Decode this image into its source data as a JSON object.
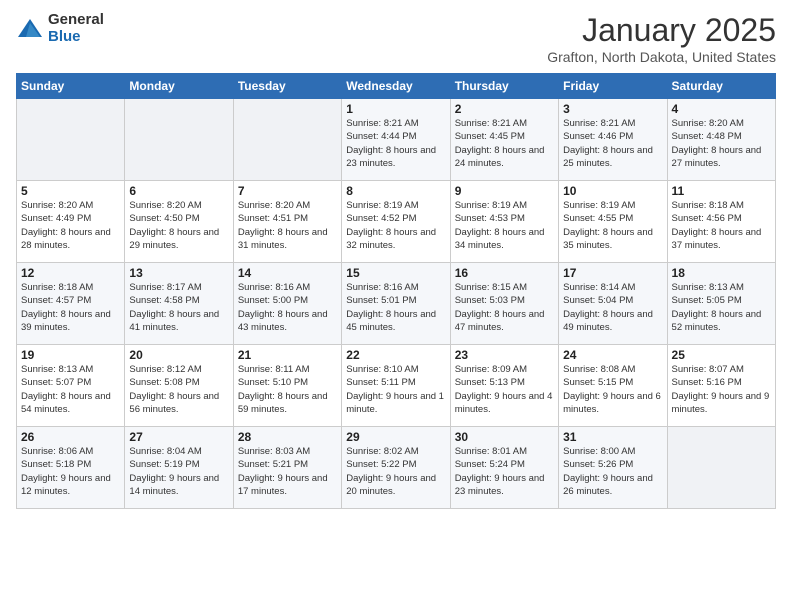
{
  "header": {
    "logo_general": "General",
    "logo_blue": "Blue",
    "month_title": "January 2025",
    "location": "Grafton, North Dakota, United States"
  },
  "weekdays": [
    "Sunday",
    "Monday",
    "Tuesday",
    "Wednesday",
    "Thursday",
    "Friday",
    "Saturday"
  ],
  "weeks": [
    [
      {
        "day": "",
        "info": ""
      },
      {
        "day": "",
        "info": ""
      },
      {
        "day": "",
        "info": ""
      },
      {
        "day": "1",
        "info": "Sunrise: 8:21 AM\nSunset: 4:44 PM\nDaylight: 8 hours and 23 minutes."
      },
      {
        "day": "2",
        "info": "Sunrise: 8:21 AM\nSunset: 4:45 PM\nDaylight: 8 hours and 24 minutes."
      },
      {
        "day": "3",
        "info": "Sunrise: 8:21 AM\nSunset: 4:46 PM\nDaylight: 8 hours and 25 minutes."
      },
      {
        "day": "4",
        "info": "Sunrise: 8:20 AM\nSunset: 4:48 PM\nDaylight: 8 hours and 27 minutes."
      }
    ],
    [
      {
        "day": "5",
        "info": "Sunrise: 8:20 AM\nSunset: 4:49 PM\nDaylight: 8 hours and 28 minutes."
      },
      {
        "day": "6",
        "info": "Sunrise: 8:20 AM\nSunset: 4:50 PM\nDaylight: 8 hours and 29 minutes."
      },
      {
        "day": "7",
        "info": "Sunrise: 8:20 AM\nSunset: 4:51 PM\nDaylight: 8 hours and 31 minutes."
      },
      {
        "day": "8",
        "info": "Sunrise: 8:19 AM\nSunset: 4:52 PM\nDaylight: 8 hours and 32 minutes."
      },
      {
        "day": "9",
        "info": "Sunrise: 8:19 AM\nSunset: 4:53 PM\nDaylight: 8 hours and 34 minutes."
      },
      {
        "day": "10",
        "info": "Sunrise: 8:19 AM\nSunset: 4:55 PM\nDaylight: 8 hours and 35 minutes."
      },
      {
        "day": "11",
        "info": "Sunrise: 8:18 AM\nSunset: 4:56 PM\nDaylight: 8 hours and 37 minutes."
      }
    ],
    [
      {
        "day": "12",
        "info": "Sunrise: 8:18 AM\nSunset: 4:57 PM\nDaylight: 8 hours and 39 minutes."
      },
      {
        "day": "13",
        "info": "Sunrise: 8:17 AM\nSunset: 4:58 PM\nDaylight: 8 hours and 41 minutes."
      },
      {
        "day": "14",
        "info": "Sunrise: 8:16 AM\nSunset: 5:00 PM\nDaylight: 8 hours and 43 minutes."
      },
      {
        "day": "15",
        "info": "Sunrise: 8:16 AM\nSunset: 5:01 PM\nDaylight: 8 hours and 45 minutes."
      },
      {
        "day": "16",
        "info": "Sunrise: 8:15 AM\nSunset: 5:03 PM\nDaylight: 8 hours and 47 minutes."
      },
      {
        "day": "17",
        "info": "Sunrise: 8:14 AM\nSunset: 5:04 PM\nDaylight: 8 hours and 49 minutes."
      },
      {
        "day": "18",
        "info": "Sunrise: 8:13 AM\nSunset: 5:05 PM\nDaylight: 8 hours and 52 minutes."
      }
    ],
    [
      {
        "day": "19",
        "info": "Sunrise: 8:13 AM\nSunset: 5:07 PM\nDaylight: 8 hours and 54 minutes."
      },
      {
        "day": "20",
        "info": "Sunrise: 8:12 AM\nSunset: 5:08 PM\nDaylight: 8 hours and 56 minutes."
      },
      {
        "day": "21",
        "info": "Sunrise: 8:11 AM\nSunset: 5:10 PM\nDaylight: 8 hours and 59 minutes."
      },
      {
        "day": "22",
        "info": "Sunrise: 8:10 AM\nSunset: 5:11 PM\nDaylight: 9 hours and 1 minute."
      },
      {
        "day": "23",
        "info": "Sunrise: 8:09 AM\nSunset: 5:13 PM\nDaylight: 9 hours and 4 minutes."
      },
      {
        "day": "24",
        "info": "Sunrise: 8:08 AM\nSunset: 5:15 PM\nDaylight: 9 hours and 6 minutes."
      },
      {
        "day": "25",
        "info": "Sunrise: 8:07 AM\nSunset: 5:16 PM\nDaylight: 9 hours and 9 minutes."
      }
    ],
    [
      {
        "day": "26",
        "info": "Sunrise: 8:06 AM\nSunset: 5:18 PM\nDaylight: 9 hours and 12 minutes."
      },
      {
        "day": "27",
        "info": "Sunrise: 8:04 AM\nSunset: 5:19 PM\nDaylight: 9 hours and 14 minutes."
      },
      {
        "day": "28",
        "info": "Sunrise: 8:03 AM\nSunset: 5:21 PM\nDaylight: 9 hours and 17 minutes."
      },
      {
        "day": "29",
        "info": "Sunrise: 8:02 AM\nSunset: 5:22 PM\nDaylight: 9 hours and 20 minutes."
      },
      {
        "day": "30",
        "info": "Sunrise: 8:01 AM\nSunset: 5:24 PM\nDaylight: 9 hours and 23 minutes."
      },
      {
        "day": "31",
        "info": "Sunrise: 8:00 AM\nSunset: 5:26 PM\nDaylight: 9 hours and 26 minutes."
      },
      {
        "day": "",
        "info": ""
      }
    ]
  ]
}
